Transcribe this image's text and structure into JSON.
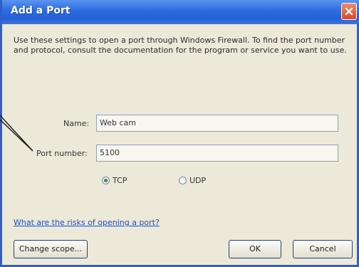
{
  "window": {
    "title": "Add a Port",
    "close_icon": "close-icon",
    "title_bar_color": "#2f6ee0"
  },
  "description": "Use these settings to open a port through Windows Firewall. To find the port number and protocol, consult the documentation for the program or service you want to use.",
  "form": {
    "name_label": "Name:",
    "name_value": "Web cam",
    "port_label": "Port number:",
    "port_value": "5100",
    "protocol_options": [
      {
        "label": "TCP",
        "selected": true
      },
      {
        "label": "UDP",
        "selected": false
      }
    ]
  },
  "risk_link": "What are the risks of opening a port?",
  "buttons": {
    "change_scope": "Change scope...",
    "ok": "OK",
    "cancel": "Cancel"
  }
}
